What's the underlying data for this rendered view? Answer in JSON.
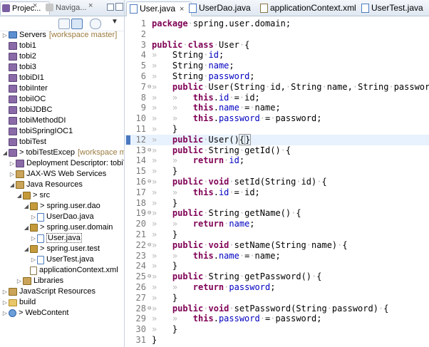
{
  "explorer": {
    "tabs": [
      {
        "label": "Projec...",
        "active": true
      },
      {
        "label": "Naviga...",
        "active": false
      }
    ],
    "close_glyph": "×",
    "tree": [
      {
        "indent": 0,
        "twisty": "▷",
        "icon": "server",
        "label": "Servers",
        "deco": "[workspace master]"
      },
      {
        "indent": 0,
        "twisty": "",
        "icon": "project",
        "label": "tobi1"
      },
      {
        "indent": 0,
        "twisty": "",
        "icon": "project",
        "label": "tobi2"
      },
      {
        "indent": 0,
        "twisty": "",
        "icon": "project",
        "label": "tobi3"
      },
      {
        "indent": 0,
        "twisty": "",
        "icon": "project",
        "label": "tobiDI1"
      },
      {
        "indent": 0,
        "twisty": "",
        "icon": "project",
        "label": "tobiInter"
      },
      {
        "indent": 0,
        "twisty": "",
        "icon": "project",
        "label": "tobiIOC"
      },
      {
        "indent": 0,
        "twisty": "",
        "icon": "project",
        "label": "tobiJDBC"
      },
      {
        "indent": 0,
        "twisty": "",
        "icon": "project",
        "label": "tobiMethodDI"
      },
      {
        "indent": 0,
        "twisty": "",
        "icon": "project",
        "label": "tobiSpringIOC1"
      },
      {
        "indent": 0,
        "twisty": "",
        "icon": "project",
        "label": "tobiTest"
      },
      {
        "indent": 0,
        "twisty": "◢",
        "icon": "project",
        "label": "> tobiTestExcep",
        "deco": "[workspace maste"
      },
      {
        "indent": 1,
        "twisty": "▷",
        "icon": "project",
        "label": "Deployment Descriptor: tobiTes"
      },
      {
        "indent": 1,
        "twisty": "▷",
        "icon": "jar",
        "label": "JAX-WS Web Services"
      },
      {
        "indent": 1,
        "twisty": "◢",
        "icon": "jar",
        "label": "Java Resources"
      },
      {
        "indent": 2,
        "twisty": "◢",
        "icon": "pkg",
        "label": "> src"
      },
      {
        "indent": 3,
        "twisty": "◢",
        "icon": "pkg",
        "label": "> spring.user.dao"
      },
      {
        "indent": 4,
        "twisty": "▷",
        "icon": "java",
        "label": "UserDao.java"
      },
      {
        "indent": 3,
        "twisty": "◢",
        "icon": "pkg",
        "label": "> spring.user.domain"
      },
      {
        "indent": 4,
        "twisty": "▷",
        "icon": "java",
        "label": "User.java",
        "selected": true
      },
      {
        "indent": 3,
        "twisty": "◢",
        "icon": "pkg",
        "label": "> spring.user.test"
      },
      {
        "indent": 4,
        "twisty": "▷",
        "icon": "java",
        "label": "UserTest.java"
      },
      {
        "indent": 3,
        "twisty": "",
        "icon": "xml",
        "label": "applicationContext.xml"
      },
      {
        "indent": 2,
        "twisty": "▷",
        "icon": "jar",
        "label": "Libraries"
      },
      {
        "indent": 0,
        "twisty": "▷",
        "icon": "jar",
        "label": "JavaScript Resources"
      },
      {
        "indent": 0,
        "twisty": "▷",
        "icon": "folder",
        "label": "build"
      },
      {
        "indent": 0,
        "twisty": "▷",
        "icon": "web",
        "label": "> WebContent"
      }
    ]
  },
  "editor": {
    "tabs": [
      {
        "label": "User.java",
        "active": true,
        "type": "java"
      },
      {
        "label": "UserDao.java",
        "active": false,
        "type": "java"
      },
      {
        "label": "applicationContext.xml",
        "active": false,
        "type": "xml"
      },
      {
        "label": "UserTest.java",
        "active": false,
        "type": "java"
      }
    ],
    "close_glyph": "×",
    "current_line": 12,
    "lines": [
      {
        "n": "1",
        "fold": "",
        "segs": [
          [
            "kw",
            "package"
          ],
          [
            "sp",
            "·"
          ],
          [
            "t",
            "spring.user.domain;"
          ]
        ]
      },
      {
        "n": "2",
        "fold": "",
        "segs": []
      },
      {
        "n": "3",
        "fold": "",
        "segs": [
          [
            "kw",
            "public"
          ],
          [
            "sp",
            "·"
          ],
          [
            "kw",
            "class"
          ],
          [
            "sp",
            "·"
          ],
          [
            "t",
            "User"
          ],
          [
            "sp",
            "·"
          ],
          [
            "t",
            "{"
          ]
        ]
      },
      {
        "n": "4",
        "fold": "",
        "segs": [
          [
            "ws",
            "»   "
          ],
          [
            "t",
            "String"
          ],
          [
            "sp",
            "·"
          ],
          [
            "fld",
            "id"
          ],
          [
            "t",
            ";"
          ]
        ]
      },
      {
        "n": "5",
        "fold": "",
        "segs": [
          [
            "ws",
            "»   "
          ],
          [
            "t",
            "String"
          ],
          [
            "sp",
            "·"
          ],
          [
            "fld",
            "name"
          ],
          [
            "t",
            ";"
          ]
        ]
      },
      {
        "n": "6",
        "fold": "",
        "segs": [
          [
            "ws",
            "»   "
          ],
          [
            "t",
            "String"
          ],
          [
            "sp",
            "·"
          ],
          [
            "fld",
            "password"
          ],
          [
            "t",
            ";"
          ]
        ]
      },
      {
        "n": "7",
        "fold": "⊖",
        "segs": [
          [
            "ws",
            "»   "
          ],
          [
            "kw",
            "public"
          ],
          [
            "sp",
            "·"
          ],
          [
            "t",
            "User(String"
          ],
          [
            "sp",
            "·"
          ],
          [
            "t",
            "id,"
          ],
          [
            "sp",
            "·"
          ],
          [
            "t",
            "String"
          ],
          [
            "sp",
            "·"
          ],
          [
            "t",
            "name,"
          ],
          [
            "sp",
            "·"
          ],
          [
            "t",
            "String"
          ],
          [
            "sp",
            "·"
          ],
          [
            "t",
            "password)"
          ],
          [
            "sp",
            "·"
          ],
          [
            "t",
            "{"
          ]
        ]
      },
      {
        "n": "8",
        "fold": "",
        "segs": [
          [
            "ws",
            "»   »   "
          ],
          [
            "kw",
            "this"
          ],
          [
            "t",
            "."
          ],
          [
            "fld",
            "id"
          ],
          [
            "sp",
            "·"
          ],
          [
            "t",
            "="
          ],
          [
            "sp",
            "·"
          ],
          [
            "t",
            "id;"
          ]
        ]
      },
      {
        "n": "9",
        "fold": "",
        "segs": [
          [
            "ws",
            "»   »   "
          ],
          [
            "kw",
            "this"
          ],
          [
            "t",
            "."
          ],
          [
            "fld",
            "name"
          ],
          [
            "sp",
            "·"
          ],
          [
            "t",
            "="
          ],
          [
            "sp",
            "·"
          ],
          [
            "t",
            "name;"
          ]
        ]
      },
      {
        "n": "10",
        "fold": "",
        "segs": [
          [
            "ws",
            "»   »   "
          ],
          [
            "kw",
            "this"
          ],
          [
            "t",
            "."
          ],
          [
            "fld",
            "password"
          ],
          [
            "sp",
            "·"
          ],
          [
            "t",
            "="
          ],
          [
            "sp",
            "·"
          ],
          [
            "t",
            "password;"
          ]
        ]
      },
      {
        "n": "11",
        "fold": "",
        "segs": [
          [
            "ws",
            "»   "
          ],
          [
            "t",
            "}"
          ]
        ]
      },
      {
        "n": "12",
        "fold": "",
        "segs": [
          [
            "ws",
            "»   "
          ],
          [
            "kw",
            "public"
          ],
          [
            "sp",
            "·"
          ],
          [
            "t",
            "User()"
          ],
          [
            "brk",
            "{"
          ],
          [
            "caret",
            ""
          ],
          [
            "brk",
            "}"
          ]
        ]
      },
      {
        "n": "13",
        "fold": "⊖",
        "segs": [
          [
            "ws",
            "»   "
          ],
          [
            "kw",
            "public"
          ],
          [
            "sp",
            "·"
          ],
          [
            "t",
            "String"
          ],
          [
            "sp",
            "·"
          ],
          [
            "t",
            "getId()"
          ],
          [
            "sp",
            "·"
          ],
          [
            "t",
            "{"
          ]
        ]
      },
      {
        "n": "14",
        "fold": "",
        "segs": [
          [
            "ws",
            "»   »   "
          ],
          [
            "kw",
            "return"
          ],
          [
            "sp",
            "·"
          ],
          [
            "fld",
            "id"
          ],
          [
            "t",
            ";"
          ]
        ]
      },
      {
        "n": "15",
        "fold": "",
        "segs": [
          [
            "ws",
            "»   "
          ],
          [
            "t",
            "}"
          ]
        ]
      },
      {
        "n": "16",
        "fold": "⊖",
        "segs": [
          [
            "ws",
            "»   "
          ],
          [
            "kw",
            "public"
          ],
          [
            "sp",
            "·"
          ],
          [
            "kw",
            "void"
          ],
          [
            "sp",
            "·"
          ],
          [
            "t",
            "setId(String"
          ],
          [
            "sp",
            "·"
          ],
          [
            "t",
            "id)"
          ],
          [
            "sp",
            "·"
          ],
          [
            "t",
            "{"
          ]
        ]
      },
      {
        "n": "17",
        "fold": "",
        "segs": [
          [
            "ws",
            "»   »   "
          ],
          [
            "kw",
            "this"
          ],
          [
            "t",
            "."
          ],
          [
            "fld",
            "id"
          ],
          [
            "sp",
            "·"
          ],
          [
            "t",
            "="
          ],
          [
            "sp",
            "·"
          ],
          [
            "t",
            "id;"
          ]
        ]
      },
      {
        "n": "18",
        "fold": "",
        "segs": [
          [
            "ws",
            "»   "
          ],
          [
            "t",
            "}"
          ]
        ]
      },
      {
        "n": "19",
        "fold": "⊖",
        "segs": [
          [
            "ws",
            "»   "
          ],
          [
            "kw",
            "public"
          ],
          [
            "sp",
            "·"
          ],
          [
            "t",
            "String"
          ],
          [
            "sp",
            "·"
          ],
          [
            "t",
            "getName()"
          ],
          [
            "sp",
            "·"
          ],
          [
            "t",
            "{"
          ]
        ]
      },
      {
        "n": "20",
        "fold": "",
        "segs": [
          [
            "ws",
            "»   »   "
          ],
          [
            "kw",
            "return"
          ],
          [
            "sp",
            "·"
          ],
          [
            "fld",
            "name"
          ],
          [
            "t",
            ";"
          ]
        ]
      },
      {
        "n": "21",
        "fold": "",
        "segs": [
          [
            "ws",
            "»   "
          ],
          [
            "t",
            "}"
          ]
        ]
      },
      {
        "n": "22",
        "fold": "⊖",
        "segs": [
          [
            "ws",
            "»   "
          ],
          [
            "kw",
            "public"
          ],
          [
            "sp",
            "·"
          ],
          [
            "kw",
            "void"
          ],
          [
            "sp",
            "·"
          ],
          [
            "t",
            "setName(String"
          ],
          [
            "sp",
            "·"
          ],
          [
            "t",
            "name)"
          ],
          [
            "sp",
            "·"
          ],
          [
            "t",
            "{"
          ]
        ]
      },
      {
        "n": "23",
        "fold": "",
        "segs": [
          [
            "ws",
            "»   »   "
          ],
          [
            "kw",
            "this"
          ],
          [
            "t",
            "."
          ],
          [
            "fld",
            "name"
          ],
          [
            "sp",
            "·"
          ],
          [
            "t",
            "="
          ],
          [
            "sp",
            "·"
          ],
          [
            "t",
            "name;"
          ]
        ]
      },
      {
        "n": "24",
        "fold": "",
        "segs": [
          [
            "ws",
            "»   "
          ],
          [
            "t",
            "}"
          ]
        ]
      },
      {
        "n": "25",
        "fold": "⊖",
        "segs": [
          [
            "ws",
            "»   "
          ],
          [
            "kw",
            "public"
          ],
          [
            "sp",
            "·"
          ],
          [
            "t",
            "String"
          ],
          [
            "sp",
            "·"
          ],
          [
            "t",
            "getPassword()"
          ],
          [
            "sp",
            "·"
          ],
          [
            "t",
            "{"
          ]
        ]
      },
      {
        "n": "26",
        "fold": "",
        "segs": [
          [
            "ws",
            "»   »   "
          ],
          [
            "kw",
            "return"
          ],
          [
            "sp",
            "·"
          ],
          [
            "fld",
            "password"
          ],
          [
            "t",
            ";"
          ]
        ]
      },
      {
        "n": "27",
        "fold": "",
        "segs": [
          [
            "ws",
            "»   "
          ],
          [
            "t",
            "}"
          ]
        ]
      },
      {
        "n": "28",
        "fold": "⊖",
        "segs": [
          [
            "ws",
            "»   "
          ],
          [
            "kw",
            "public"
          ],
          [
            "sp",
            "·"
          ],
          [
            "kw",
            "void"
          ],
          [
            "sp",
            "·"
          ],
          [
            "t",
            "setPassword(String"
          ],
          [
            "sp",
            "·"
          ],
          [
            "t",
            "password)"
          ],
          [
            "sp",
            "·"
          ],
          [
            "t",
            "{"
          ]
        ]
      },
      {
        "n": "29",
        "fold": "",
        "segs": [
          [
            "ws",
            "»   »   "
          ],
          [
            "kw",
            "this"
          ],
          [
            "t",
            "."
          ],
          [
            "fld",
            "password"
          ],
          [
            "sp",
            "·"
          ],
          [
            "t",
            "="
          ],
          [
            "sp",
            "·"
          ],
          [
            "t",
            "password;"
          ]
        ]
      },
      {
        "n": "30",
        "fold": "",
        "segs": [
          [
            "ws",
            "»   "
          ],
          [
            "t",
            "}"
          ]
        ]
      },
      {
        "n": "31",
        "fold": "",
        "segs": [
          [
            "t",
            "}"
          ]
        ]
      }
    ]
  }
}
